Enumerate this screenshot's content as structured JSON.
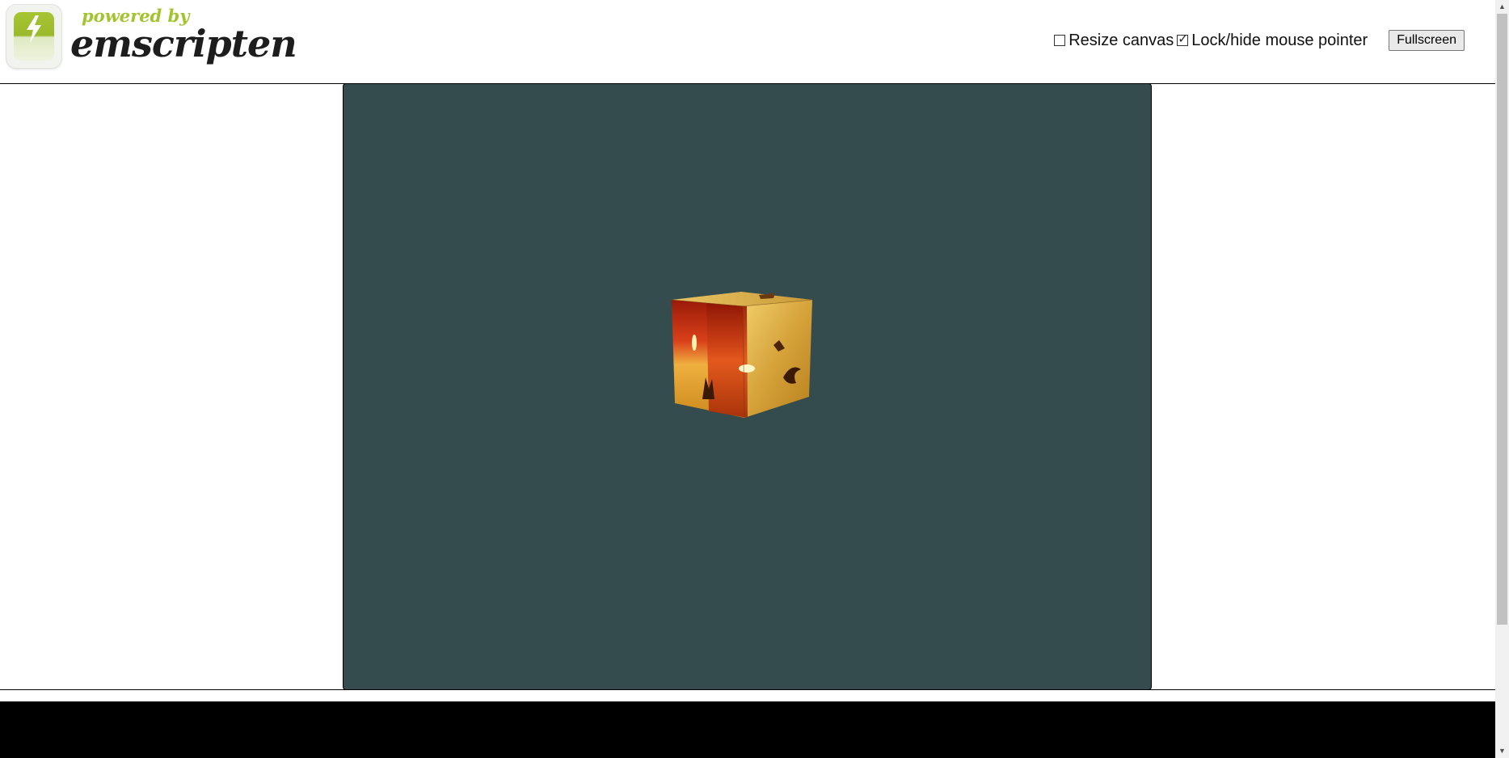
{
  "header": {
    "logo": {
      "powered_by": "powered by",
      "brand": "emscripten",
      "icon": "lightning-icon"
    },
    "controls": {
      "resize_canvas": {
        "label": "Resize canvas",
        "checked": false
      },
      "lock_pointer": {
        "label": "Lock/hide mouse pointer",
        "checked": true
      },
      "fullscreen_label": "Fullscreen"
    }
  },
  "canvas": {
    "background": "#344c4e",
    "content": "textured-rotating-cube"
  },
  "output": {
    "background": "#000000",
    "text": ""
  },
  "scrollbar": {
    "up_icon": "scroll-up-arrow-icon",
    "down_icon": "scroll-down-arrow-icon"
  }
}
